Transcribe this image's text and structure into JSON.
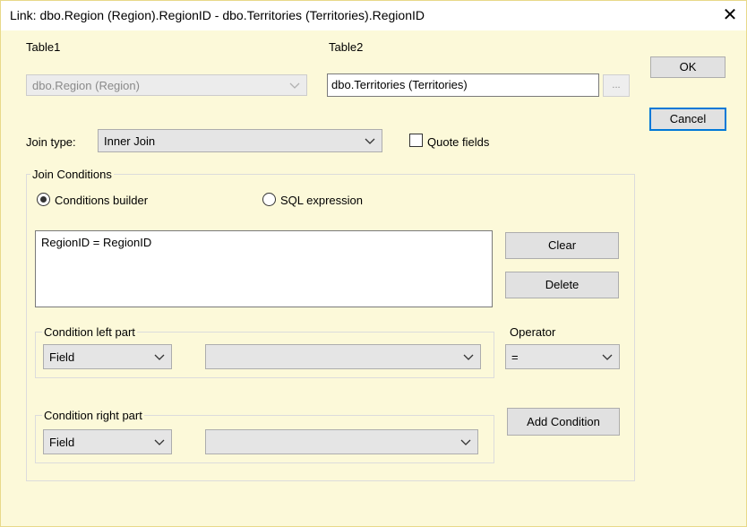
{
  "window": {
    "title": "Link: dbo.Region (Region).RegionID - dbo.Territories (Territories).RegionID",
    "close_glyph": "✕"
  },
  "table1": {
    "label": "Table1",
    "value": "dbo.Region (Region)"
  },
  "table2": {
    "label": "Table2",
    "value": "dbo.Territories (Territories)",
    "browse_label": "..."
  },
  "buttons": {
    "ok": "OK",
    "cancel": "Cancel",
    "clear": "Clear",
    "delete": "Delete",
    "add_condition": "Add Condition"
  },
  "join": {
    "label": "Join type:",
    "value": "Inner Join"
  },
  "quote_fields": {
    "label": "Quote fields",
    "checked": false
  },
  "join_conditions": {
    "group_label": "Join Conditions",
    "mode_builder": "Conditions builder",
    "mode_sql": "SQL expression",
    "selected_mode": "Conditions builder",
    "conditions": [
      "RegionID = RegionID"
    ]
  },
  "left_part": {
    "label": "Condition left part",
    "type_value": "Field",
    "field_value": ""
  },
  "operator": {
    "label": "Operator",
    "value": "="
  },
  "right_part": {
    "label": "Condition right part",
    "type_value": "Field",
    "field_value": ""
  },
  "icons": {
    "dropdown": "chevron-down-icon",
    "close": "close-icon"
  }
}
